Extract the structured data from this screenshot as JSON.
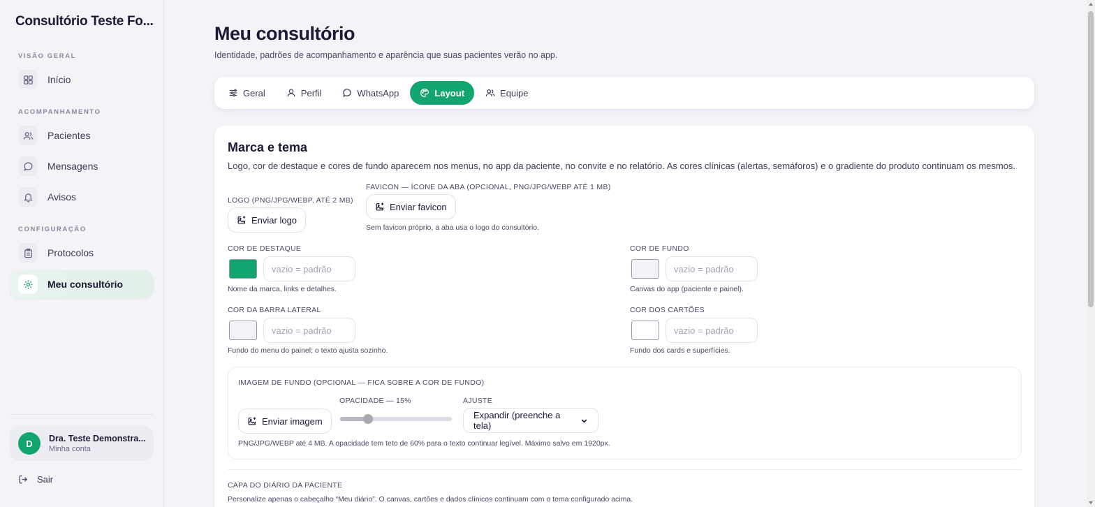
{
  "sidebar": {
    "brand": "Consultório Teste Fo...",
    "sections": {
      "overview": "VISÃO GERAL",
      "tracking": "ACOMPANHAMENTO",
      "config": "CONFIGURAÇÃO"
    },
    "items": {
      "inicio": "Início",
      "pacientes": "Pacientes",
      "mensagens": "Mensagens",
      "avisos": "Avisos",
      "protocolos": "Protocolos",
      "consultorio": "Meu consultório"
    },
    "user": {
      "initial": "D",
      "name": "Dra. Teste Demonstra...",
      "subtitle": "Minha conta"
    },
    "logout": "Sair"
  },
  "header": {
    "title": "Meu consultório",
    "subtitle": "Identidade, padrões de acompanhamento e aparência que suas pacientes verão no app."
  },
  "tabs": {
    "geral": "Geral",
    "perfil": "Perfil",
    "whatsapp": "WhatsApp",
    "layout": "Layout",
    "equipe": "Equipe"
  },
  "brand_section": {
    "title": "Marca e tema",
    "description": "Logo, cor de destaque e cores de fundo aparecem nos menus, no app da paciente, no convite e no relatório. As cores clínicas (alertas, semáforos) e o gradiente do produto continuam os mesmos.",
    "logo_label": "LOGO (PNG/JPG/WEBP, ATÉ 2 MB)",
    "logo_button": "Enviar logo",
    "favicon_label": "FAVICON — ÍCONE DA ABA (OPCIONAL, PNG/JPG/WEBP ATÉ 1 MB)",
    "favicon_button": "Enviar favicon",
    "favicon_hint": "Sem favicon próprio, a aba usa o logo do consultório.",
    "accent_label": "COR DE DESTAQUE",
    "accent_color": "#13a56e",
    "accent_hint": "Nome da marca, links e detalhes.",
    "bg_label": "COR DE FUNDO",
    "bg_color": "#f2f2f7",
    "bg_hint": "Canvas do app (paciente e painel).",
    "sidebar_label": "COR DA BARRA LATERAL",
    "sidebar_color": "#f2f2f7",
    "sidebar_hint": "Fundo do menu do painel; o texto ajusta sozinho.",
    "cards_label": "COR DOS CARTÕES",
    "cards_color": "#ffffff",
    "cards_hint": "Fundo dos cards e superfícies.",
    "placeholder": "vazio = padrão"
  },
  "background_image": {
    "label": "IMAGEM DE FUNDO (OPCIONAL — FICA SOBRE A COR DE FUNDO)",
    "button": "Enviar imagem",
    "opacity_label": "OPACIDADE — 15%",
    "opacity_value": 0.15,
    "opacity_max": 0.6,
    "fit_label": "AJUSTE",
    "fit_selected": "Expandir (preenche a tela)",
    "hint": "PNG/JPG/WEBP até 4 MB. A opacidade tem teto de 60% para o texto continuar legível. Máximo salvo em 1920px."
  },
  "diary_cover": {
    "label": "CAPA DO DIÁRIO DA PACIENTE",
    "description": "Personalize apenas o cabeçalho “Meu diário”. O canvas, cartões e dados clínicos continuam com o tema configurado acima."
  }
}
